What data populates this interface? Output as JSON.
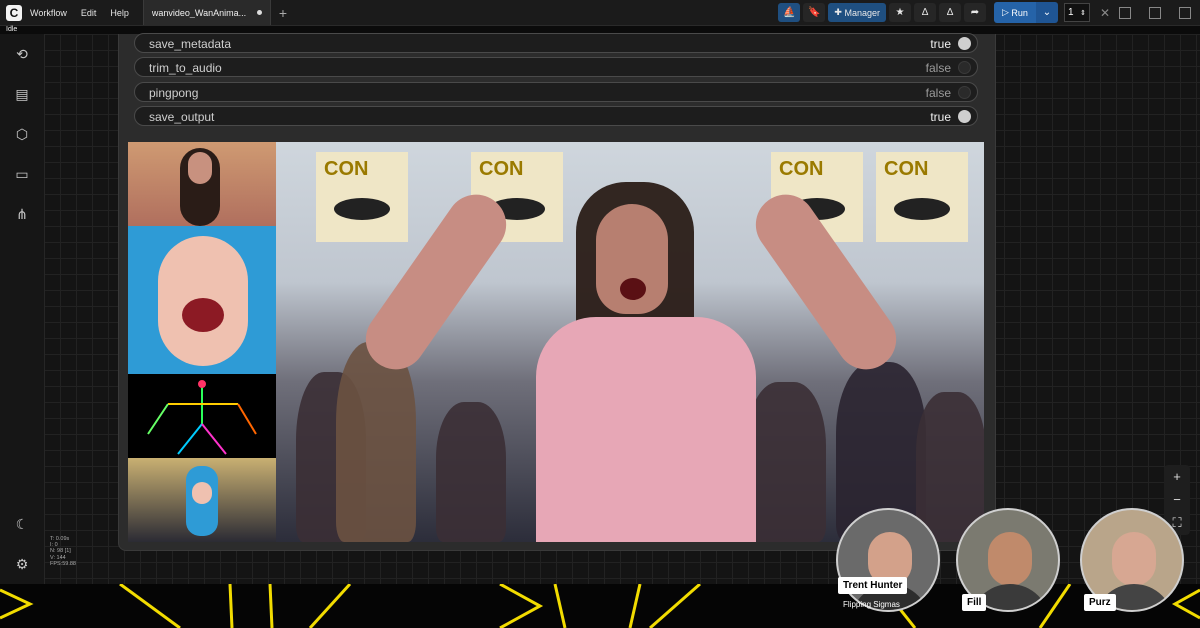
{
  "menu": {
    "logo": "C",
    "items": [
      "Workflow",
      "Edit",
      "Help"
    ]
  },
  "tab": {
    "title": "wanvideo_WanAnima...",
    "add_symbol": "+"
  },
  "toolbar": {
    "manager_label": "Manager",
    "run_label": "Run",
    "run_caret": "⌄",
    "count": "1",
    "close_symbol": "✕"
  },
  "status": "Idle",
  "sidebar_icons": [
    "history-icon",
    "book-icon",
    "cube-icon",
    "folder-icon",
    "sitemap-icon",
    "moon-icon",
    "gear-icon"
  ],
  "stats": [
    "T: 0.09s",
    "I: 0",
    "N: 98 [1]",
    "V: 144",
    "FPS:59.88"
  ],
  "widgets": [
    {
      "label": "save_metadata",
      "value": "true",
      "on": true
    },
    {
      "label": "trim_to_audio",
      "value": "false",
      "on": false
    },
    {
      "label": "pingpong",
      "value": "false",
      "on": false
    },
    {
      "label": "save_output",
      "value": "true",
      "on": true
    }
  ],
  "banner_text": "CON",
  "zoom": {
    "in": "+",
    "out": "−",
    "fit": "⛶"
  },
  "webcams": [
    {
      "name": "Trent Hunter",
      "subtitle": "Flipping Sigmas"
    },
    {
      "name": "Fill",
      "subtitle": ""
    },
    {
      "name": "Purz",
      "subtitle": ""
    }
  ],
  "colors": {
    "accent": "#2563a8",
    "band_line": "#f2dc00"
  }
}
